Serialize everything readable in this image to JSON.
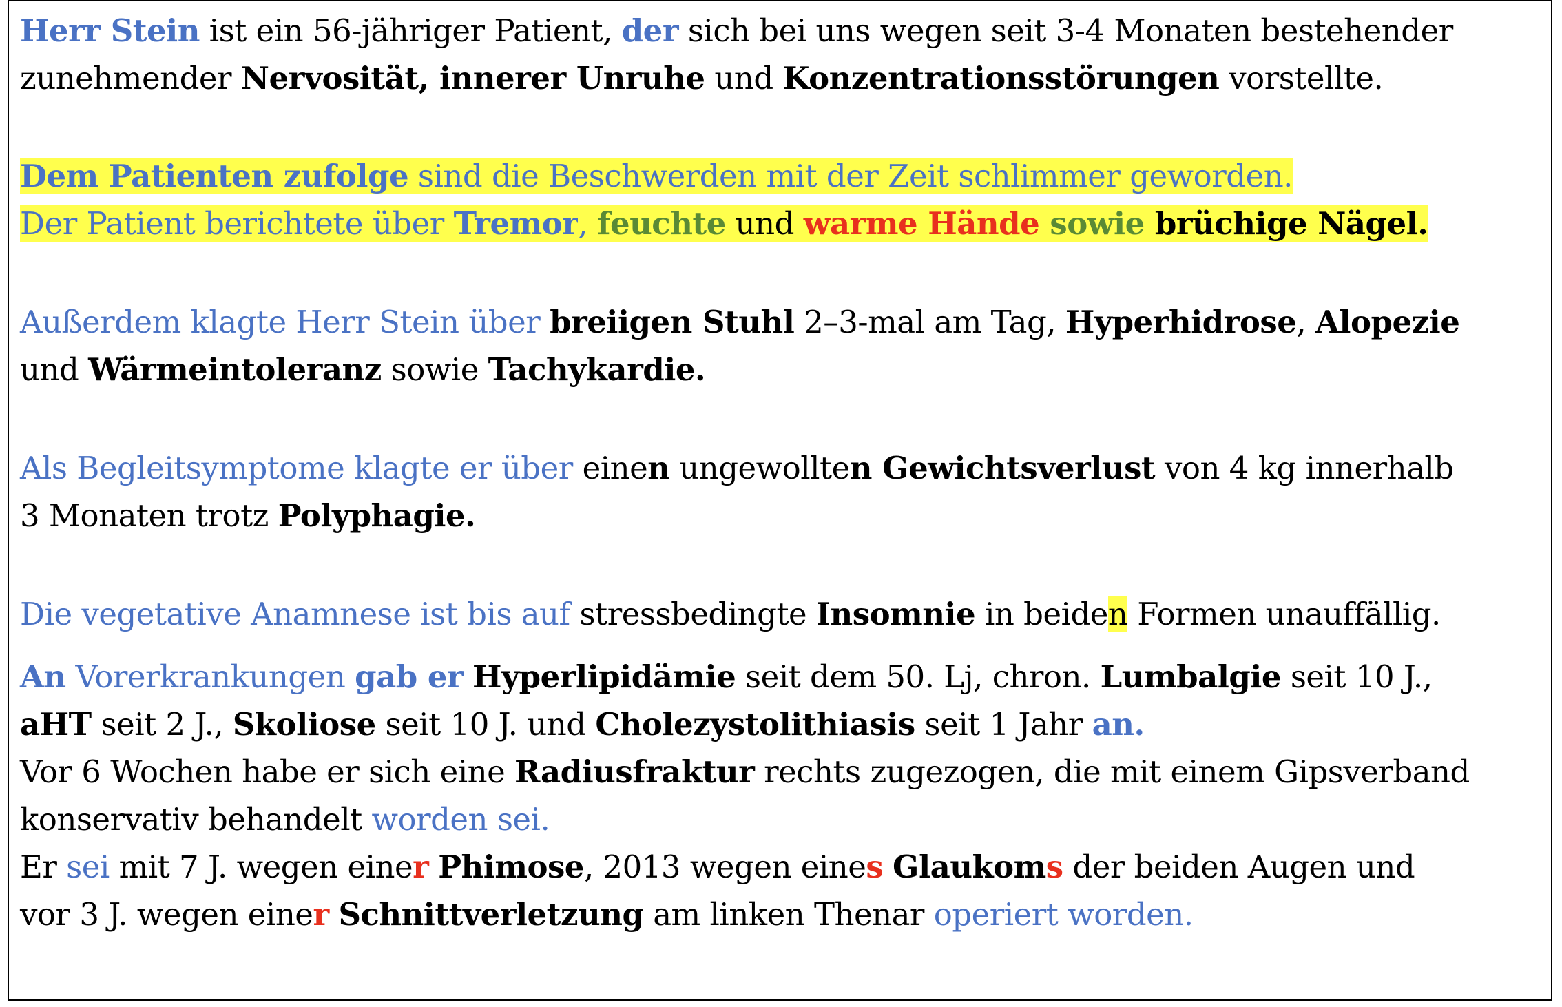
{
  "paragraphs": {
    "p1": {
      "l1": [
        {
          "t": "Herr Stein",
          "c": "b blue"
        },
        {
          "t": " ist ein 56-jähriger Patient, ",
          "c": ""
        },
        {
          "t": "der",
          "c": "b blue"
        },
        {
          "t": " sich bei uns wegen seit 3-4 Monaten bestehender",
          "c": ""
        }
      ],
      "l2": [
        {
          "t": "zunehmender ",
          "c": ""
        },
        {
          "t": "Nervosität, innerer Unruhe",
          "c": "b"
        },
        {
          "t": " und ",
          "c": ""
        },
        {
          "t": "Konzentrationsstörungen",
          "c": "b"
        },
        {
          "t": " vorstellte.",
          "c": ""
        }
      ]
    },
    "p2": {
      "l1": [
        {
          "t": "Dem Patienten zufolge",
          "c": "b blue hl"
        },
        {
          "t": " sind die Beschwerden mit der Zeit schlimmer geworden.",
          "c": "blue hl"
        }
      ],
      "l2": [
        {
          "t": "Der Patient berichtete über ",
          "c": "blue hl"
        },
        {
          "t": "Tremor",
          "c": "b blue hl"
        },
        {
          "t": ", ",
          "c": "blue hl"
        },
        {
          "t": "feuchte",
          "c": "b green hl"
        },
        {
          "t": " und ",
          "c": "hl"
        },
        {
          "t": "warme Hände",
          "c": "b red hl"
        },
        {
          "t": " sowie ",
          "c": "b green hl"
        },
        {
          "t": "brüchige Nägel.",
          "c": "b hl"
        }
      ]
    },
    "p3": {
      "l1": [
        {
          "t": "Außerdem klagte Herr Stein über ",
          "c": "blue"
        },
        {
          "t": "breiigen Stuhl",
          "c": "b"
        },
        {
          "t": " 2–3-mal am Tag, ",
          "c": ""
        },
        {
          "t": "Hyperhidrose",
          "c": "b"
        },
        {
          "t": ", ",
          "c": ""
        },
        {
          "t": "Alopezie",
          "c": "b"
        }
      ],
      "l2": [
        {
          "t": "und ",
          "c": ""
        },
        {
          "t": "Wärmeintoleranz",
          "c": "b"
        },
        {
          "t": " sowie ",
          "c": ""
        },
        {
          "t": "Tachykardie.",
          "c": "b"
        }
      ]
    },
    "p4": {
      "l1": [
        {
          "t": "Als Begleitsymptome klagte er über ",
          "c": "blue"
        },
        {
          "t": "eine",
          "c": ""
        },
        {
          "t": "n",
          "c": "b"
        },
        {
          "t": " ungewollte",
          "c": ""
        },
        {
          "t": "n Gewichtsverlust",
          "c": "b"
        },
        {
          "t": " von 4 kg innerhalb",
          "c": ""
        }
      ],
      "l2": [
        {
          "t": "3 Monaten trotz ",
          "c": ""
        },
        {
          "t": "Polyphagie.",
          "c": "b"
        }
      ]
    },
    "p5": {
      "l1": [
        {
          "t": "Die vegetative Anamnese ist bis auf ",
          "c": "blue"
        },
        {
          "t": "stressbedingte ",
          "c": ""
        },
        {
          "t": "Insomnie",
          "c": "b"
        },
        {
          "t": " in beide",
          "c": ""
        },
        {
          "t": "n",
          "c": "hl"
        },
        {
          "t": " Formen unauffällig.",
          "c": ""
        }
      ]
    },
    "p6": {
      "l1": [
        {
          "t": "An",
          "c": "b blue"
        },
        {
          "t": " Vorerkrankungen ",
          "c": "blue"
        },
        {
          "t": "gab er",
          "c": "b blue"
        },
        {
          "t": " ",
          "c": ""
        },
        {
          "t": "Hyperlipidämie",
          "c": "b"
        },
        {
          "t": " seit dem 50. Lj, chron. ",
          "c": ""
        },
        {
          "t": "Lumbalgie",
          "c": "b"
        },
        {
          "t": " seit 10 J.,",
          "c": ""
        }
      ],
      "l2": [
        {
          "t": "aHT",
          "c": "b"
        },
        {
          "t": " seit 2 J., ",
          "c": ""
        },
        {
          "t": "Skoliose",
          "c": "b"
        },
        {
          "t": " seit 10 J. und ",
          "c": ""
        },
        {
          "t": "Cholezystolithiasis",
          "c": "b"
        },
        {
          "t": " seit 1 Jahr ",
          "c": ""
        },
        {
          "t": "an.",
          "c": "b blue"
        }
      ],
      "l3": [
        {
          "t": "Vor 6 Wochen habe er sich eine ",
          "c": ""
        },
        {
          "t": "Radiusfraktur",
          "c": "b"
        },
        {
          "t": " rechts zugezogen, die mit einem Gipsverband",
          "c": ""
        }
      ],
      "l4": [
        {
          "t": "konservativ behandelt ",
          "c": ""
        },
        {
          "t": "worden sei.",
          "c": "blue"
        }
      ],
      "l5": [
        {
          "t": "Er ",
          "c": ""
        },
        {
          "t": "sei",
          "c": "blue"
        },
        {
          "t": " mit 7 J. wegen eine",
          "c": ""
        },
        {
          "t": "r",
          "c": "b red"
        },
        {
          "t": " ",
          "c": ""
        },
        {
          "t": "Phimose",
          "c": "b"
        },
        {
          "t": ", 2013 wegen eine",
          "c": ""
        },
        {
          "t": "s",
          "c": "b red"
        },
        {
          "t": " ",
          "c": ""
        },
        {
          "t": "Glaukom",
          "c": "b"
        },
        {
          "t": "s",
          "c": "b red"
        },
        {
          "t": " der beiden Augen und",
          "c": ""
        }
      ],
      "l6": [
        {
          "t": "vor 3 J. wegen eine",
          "c": ""
        },
        {
          "t": "r",
          "c": "b red"
        },
        {
          "t": " ",
          "c": ""
        },
        {
          "t": "Schnittverletzung",
          "c": "b"
        },
        {
          "t": " am linken Thenar ",
          "c": ""
        },
        {
          "t": "operiert worden.",
          "c": "blue"
        }
      ]
    }
  },
  "colors": {
    "blue": "#4a72c4",
    "green": "#5a8a35",
    "red": "#e8301e",
    "highlight": "#ffff4d"
  }
}
